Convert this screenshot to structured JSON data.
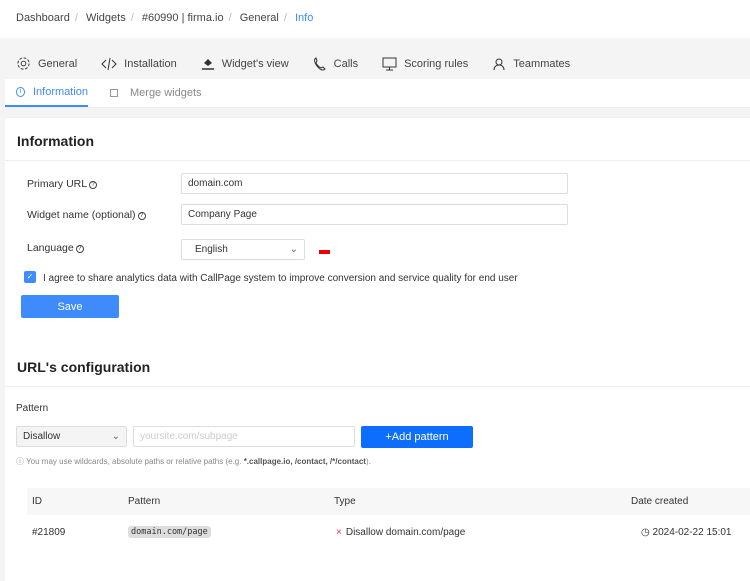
{
  "breadcrumb": [
    "Dashboard",
    "Widgets",
    "#60990 | firma.io",
    "General",
    "Info"
  ],
  "nav": [
    "General",
    "Installation",
    "Widget's view",
    "Calls",
    "Scoring rules",
    "Teammates"
  ],
  "subtabs": [
    "Information",
    "Merge widgets"
  ],
  "info": {
    "title": "Information",
    "primary_url_label": "Primary URL",
    "primary_url": "domain.com",
    "widget_name_label": "Widget name (optional)",
    "widget_name": "Company Page",
    "language_label": "Language",
    "language": "English",
    "consent": "I agree to share analytics data with CallPage system to improve conversion and service quality for end user",
    "consent_checked": true,
    "save": "Save"
  },
  "url_config": {
    "title": "URL's configuration",
    "pattern_label": "Pattern",
    "rule": "Disallow",
    "placeholder": "yoursite.com/subpage",
    "add": "+Add pattern",
    "hint_prefix": "You may use wildcards, absolute paths or relative paths (e.g. ",
    "hint_examples": "*.callpage.io, /contact, /*/contact",
    "hint_suffix": ")."
  },
  "table": {
    "headers": [
      "ID",
      "Pattern",
      "Type",
      "Date created"
    ],
    "rows": [
      {
        "id": "#21809",
        "pattern": "domain.com/page",
        "type": "Disallow domain.com/page",
        "date": "2024-02-22 15:01"
      }
    ]
  },
  "colors": {
    "accent": "#0d6efd",
    "link": "#3d8bfd"
  }
}
